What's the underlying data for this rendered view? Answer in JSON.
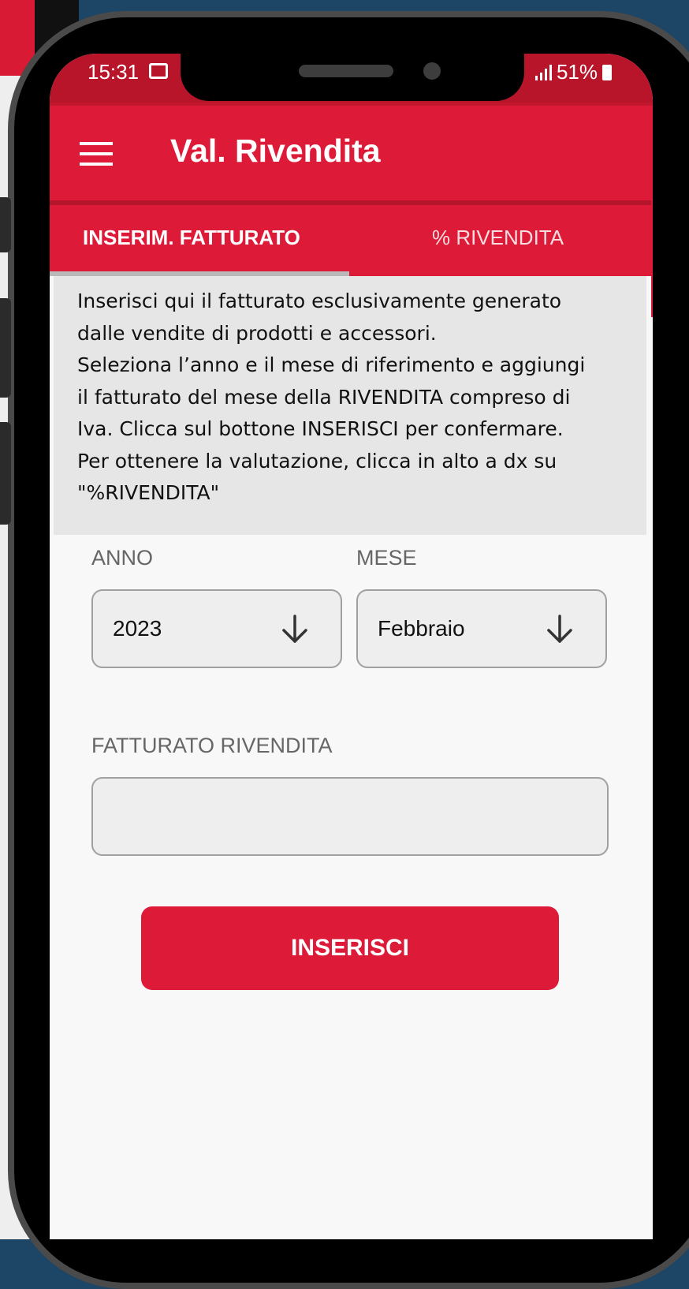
{
  "status_bar": {
    "time": "15:31",
    "battery": "51%"
  },
  "app_bar": {
    "title": "Val. Rivendita"
  },
  "tabs": [
    {
      "label": "INSERIM. FATTURATO",
      "active": true
    },
    {
      "label": "% RIVENDITA",
      "active": false
    }
  ],
  "info": {
    "lines": [
      "Inserisci qui il fatturato esclusivamente generato",
      "dalle vendite di prodotti e accessori.",
      "Seleziona l’anno e il mese di riferimento e aggiungi",
      "il fatturato del mese della RIVENDITA compreso di",
      "Iva. Clicca sul bottone INSERISCI per confermare.",
      "Per ottenere la valutazione, clicca in alto a dx su",
      "\"%RIVENDITA\""
    ]
  },
  "form": {
    "year_label": "ANNO",
    "year_value": "2023",
    "month_label": "MESE",
    "month_value": "Febbraio",
    "revenue_label": "FATTURATO RIVENDITA",
    "revenue_value": "",
    "submit_label": "INSERISCI"
  },
  "colors": {
    "primary": "#dd1a37",
    "status_bar": "#b8152b",
    "info_bg": "#e6e6e6",
    "field_bg": "#eeeeee"
  },
  "icons": [
    "menu-icon",
    "image-icon",
    "signal-icon",
    "battery-icon",
    "arrow-down-icon"
  ]
}
